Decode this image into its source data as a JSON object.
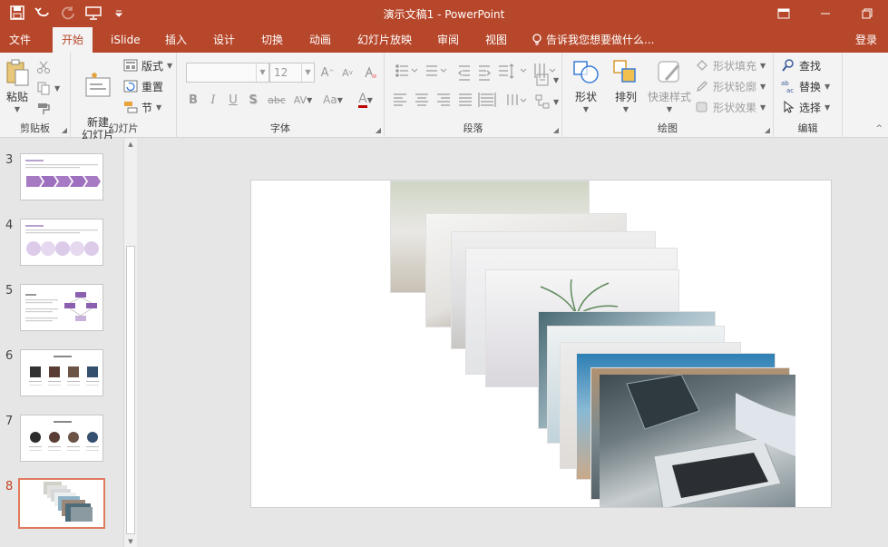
{
  "window": {
    "title": "演示文稿1 - PowerPoint",
    "colors": {
      "accent": "#b7472a",
      "ribbon_bg": "#f3f3f3",
      "selected_thumb_border": "#e07a5f"
    }
  },
  "quick_access": [
    "save-icon",
    "undo-icon",
    "redo-icon",
    "slideshow-from-start-icon",
    "customize-icon"
  ],
  "tabs": [
    {
      "label": "文件"
    },
    {
      "label": "开始"
    },
    {
      "label": "iSlide"
    },
    {
      "label": "插入"
    },
    {
      "label": "设计"
    },
    {
      "label": "切换"
    },
    {
      "label": "动画"
    },
    {
      "label": "幻灯片放映"
    },
    {
      "label": "审阅"
    },
    {
      "label": "视图"
    }
  ],
  "active_tab": "开始",
  "tell_me": "告诉我您想要做什么...",
  "login": "登录",
  "ribbon": {
    "clipboard": {
      "paste": "粘贴",
      "label": "剪贴板"
    },
    "slides": {
      "new_slide": "新建\n幻灯片",
      "layout": "版式",
      "reset": "重置",
      "section": "节",
      "label": "幻灯片"
    },
    "font": {
      "font_name": "",
      "font_size": "12",
      "label": "字体",
      "bold": "B",
      "italic": "I",
      "underline": "U",
      "shadow": "S",
      "strike": "abc",
      "spacing": "AV",
      "case": "Aa",
      "color": "A",
      "grow": "A",
      "shrink": "A"
    },
    "paragraph": {
      "label": "段落"
    },
    "drawing": {
      "shapes": "形状",
      "arrange": "排列",
      "quick_styles": "快速样式",
      "fill": "形状填充",
      "outline": "形状轮廓",
      "effects": "形状效果",
      "label": "绘图"
    },
    "editing": {
      "find": "查找",
      "replace": "替换",
      "select": "选择",
      "label": "编辑"
    }
  },
  "slides": [
    {
      "number": "3"
    },
    {
      "number": "4"
    },
    {
      "number": "5"
    },
    {
      "number": "6"
    },
    {
      "number": "7"
    },
    {
      "number": "8"
    }
  ],
  "selected_slide": "8"
}
